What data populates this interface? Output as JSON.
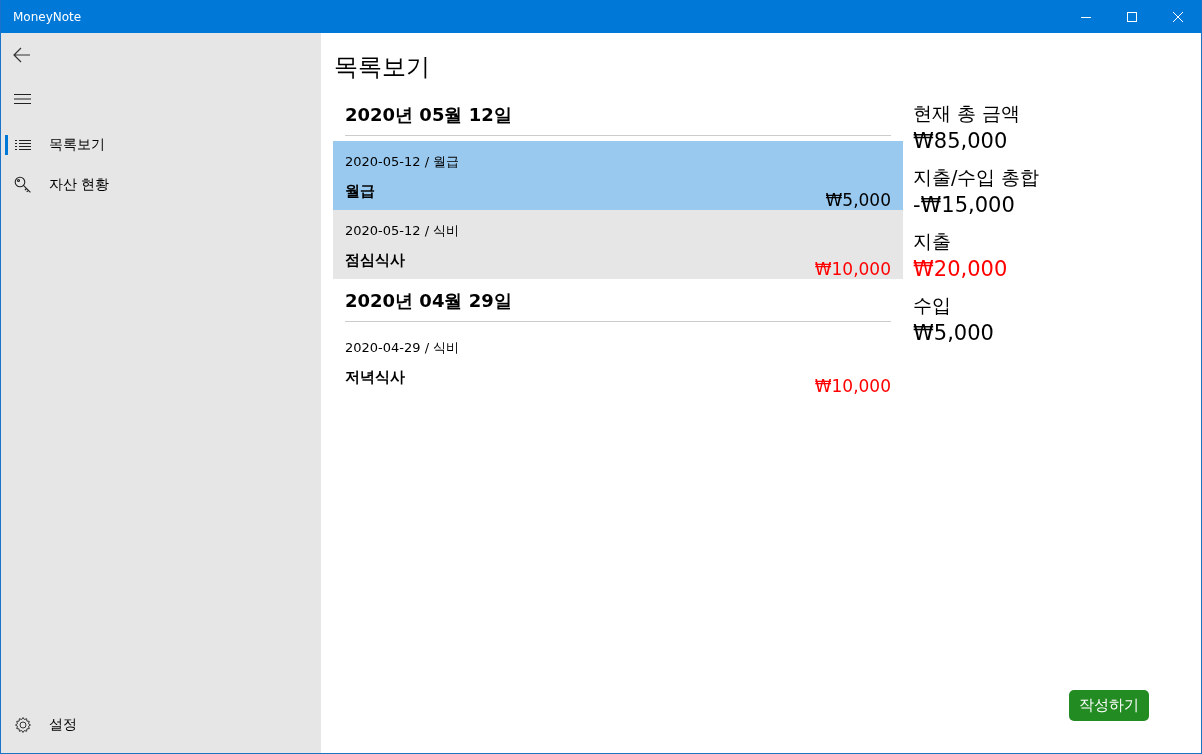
{
  "window": {
    "title": "MoneyNote"
  },
  "sidebar": {
    "items": [
      {
        "label": "목록보기",
        "selected": true
      },
      {
        "label": "자산 현황",
        "selected": false
      }
    ],
    "footer": {
      "label": "설정"
    }
  },
  "page_title": "목록보기",
  "groups": [
    {
      "heading": "2020년 05월 12일",
      "entries": [
        {
          "meta": "2020-05-12 / 월급",
          "title": "월급",
          "amount": "₩5,000",
          "kind": "income",
          "selected": true,
          "highlighted": false
        },
        {
          "meta": "2020-05-12 / 식비",
          "title": "점심식사",
          "amount": "₩10,000",
          "kind": "expense",
          "selected": false,
          "highlighted": true
        }
      ]
    },
    {
      "heading": "2020년 04월 29일",
      "entries": [
        {
          "meta": "2020-04-29 / 식비",
          "title": "저녁식사",
          "amount": "₩10,000",
          "kind": "expense",
          "selected": false,
          "highlighted": false
        }
      ]
    }
  ],
  "summary": [
    {
      "label": "현재 총 금액",
      "value": "₩85,000",
      "kind": "normal"
    },
    {
      "label": "지출/수입 총합",
      "value": "-₩15,000",
      "kind": "normal"
    },
    {
      "label": "지출",
      "value": "₩20,000",
      "kind": "expense"
    },
    {
      "label": "수입",
      "value": "₩5,000",
      "kind": "normal"
    }
  ],
  "write_button": "작성하기"
}
